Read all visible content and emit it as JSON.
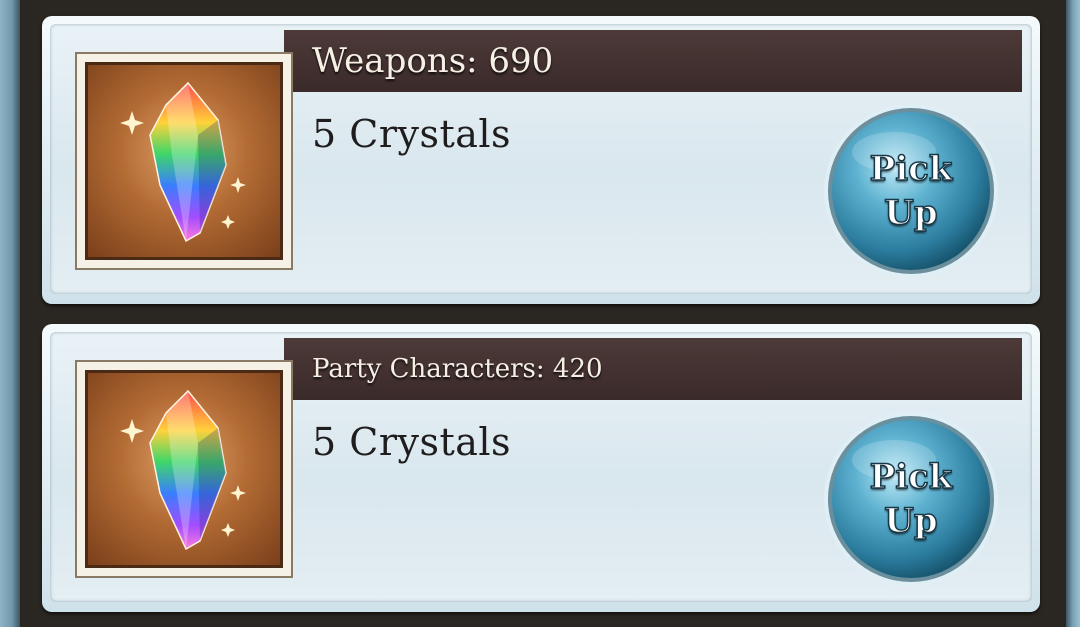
{
  "rewards": [
    {
      "category_label": "Weapons: 690",
      "reward_text": "5 Crystals",
      "icon": "rainbow-crystal-icon",
      "button_label": "Pick\nUp"
    },
    {
      "category_label": "Party Characters: 420",
      "reward_text": "5 Crystals",
      "icon": "rainbow-crystal-icon",
      "button_label": "Pick\nUp"
    }
  ],
  "colors": {
    "title_bar": "#3f2e2d",
    "button_blue": "#3b8fb0",
    "card_bg": "#dde9ef"
  }
}
